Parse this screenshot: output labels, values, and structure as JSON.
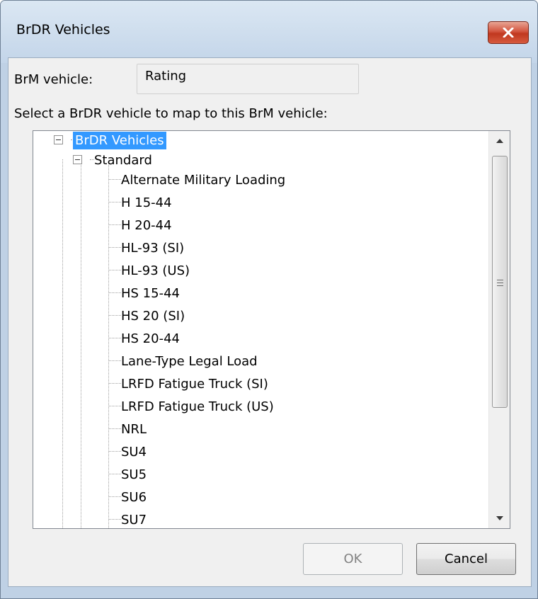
{
  "window": {
    "title": "BrDR Vehicles",
    "close_icon": "close-icon"
  },
  "form": {
    "brm_label": "BrM vehicle:",
    "brm_value": "Rating",
    "instruction": "Select a BrDR vehicle to map to this BrM vehicle:"
  },
  "tree": {
    "root": {
      "label": "BrDR Vehicles",
      "expanded": true,
      "selected": true
    },
    "group": {
      "label": "Standard",
      "expanded": true
    },
    "items": [
      "Alternate Military Loading",
      "H 15-44",
      "H 20-44",
      "HL-93 (SI)",
      "HL-93 (US)",
      "HS 15-44",
      "HS 20 (SI)",
      "HS 20-44",
      "Lane-Type Legal Load",
      "LRFD Fatigue Truck (SI)",
      "LRFD Fatigue Truck (US)",
      "NRL",
      "SU4",
      "SU5",
      "SU6",
      "SU7"
    ]
  },
  "buttons": {
    "ok_label": "OK",
    "ok_enabled": false,
    "cancel_label": "Cancel"
  },
  "colors": {
    "selection": "#3399ff",
    "close_button": "#c7402a"
  }
}
